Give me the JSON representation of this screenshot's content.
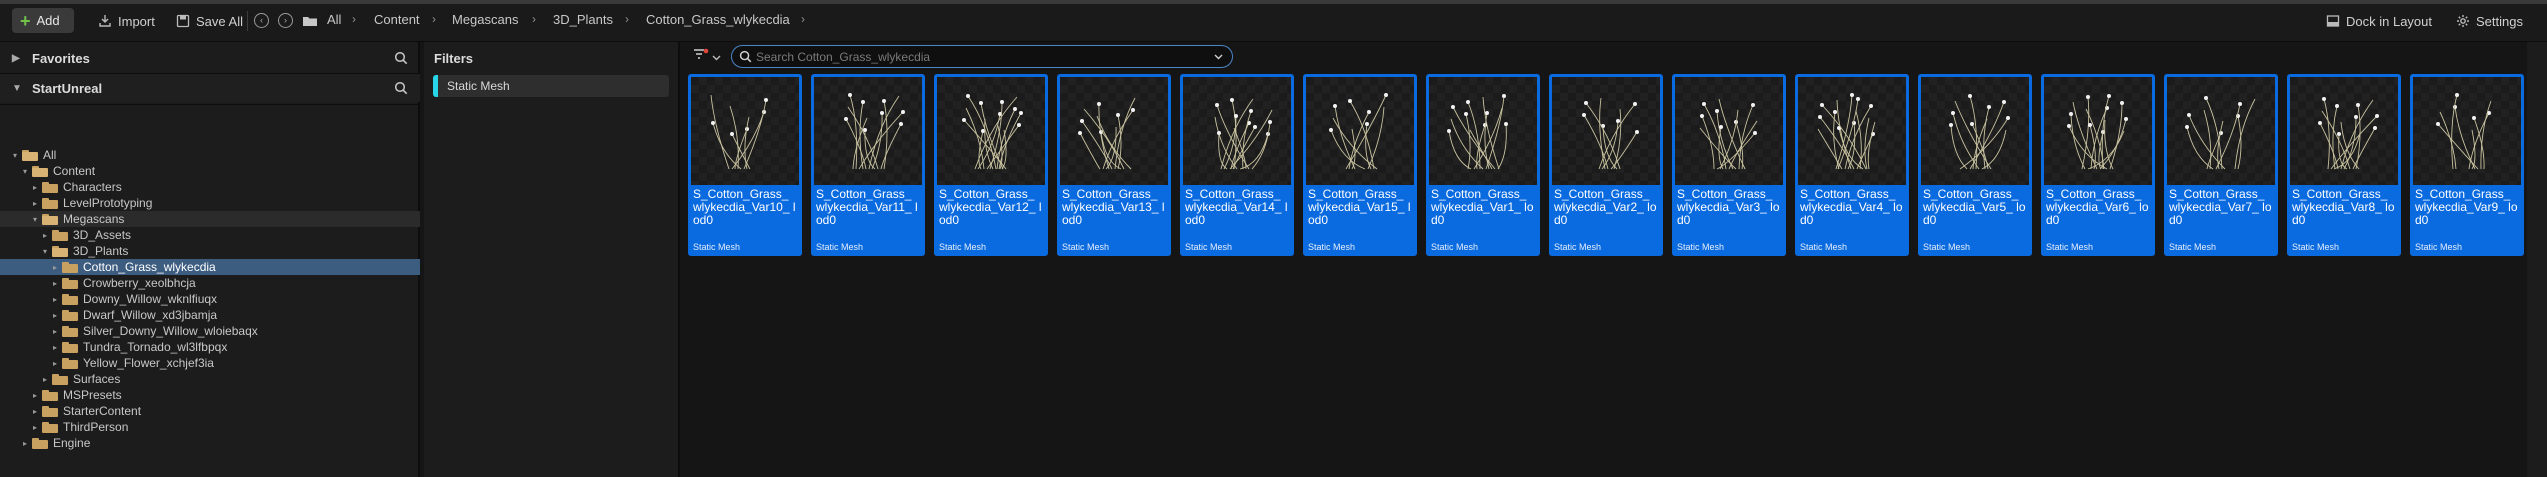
{
  "toolbar": {
    "add_label": "Add",
    "import_label": "Import",
    "save_all_label": "Save All",
    "dock_label": "Dock in Layout",
    "settings_label": "Settings"
  },
  "breadcrumb": [
    "All",
    "Content",
    "Megascans",
    "3D_Plants",
    "Cotton_Grass_wlykecdia"
  ],
  "sidebar": {
    "favorites_label": "Favorites",
    "project_label": "StartUnreal",
    "tree": [
      {
        "label": "All",
        "depth": 0,
        "expanded": true
      },
      {
        "label": "Content",
        "depth": 1,
        "expanded": true
      },
      {
        "label": "Characters",
        "depth": 2,
        "expanded": false
      },
      {
        "label": "LevelPrototyping",
        "depth": 2,
        "expanded": false
      },
      {
        "label": "Megascans",
        "depth": 2,
        "expanded": true
      },
      {
        "label": "3D_Assets",
        "depth": 3,
        "expanded": false
      },
      {
        "label": "3D_Plants",
        "depth": 3,
        "expanded": true
      },
      {
        "label": "Cotton_Grass_wlykecdia",
        "depth": 4,
        "expanded": false
      },
      {
        "label": "Crowberry_xeolbhcja",
        "depth": 4,
        "expanded": false
      },
      {
        "label": "Downy_Willow_wknlfiuqx",
        "depth": 4,
        "expanded": false
      },
      {
        "label": "Dwarf_Willow_xd3jbamja",
        "depth": 4,
        "expanded": false
      },
      {
        "label": "Silver_Downy_Willow_wloiebaqx",
        "depth": 4,
        "expanded": false
      },
      {
        "label": "Tundra_Tornado_wl3lfbpqx",
        "depth": 4,
        "expanded": false
      },
      {
        "label": "Yellow_Flower_xchjef3ia",
        "depth": 4,
        "expanded": false
      },
      {
        "label": "Surfaces",
        "depth": 3,
        "expanded": false
      },
      {
        "label": "MSPresets",
        "depth": 2,
        "expanded": false
      },
      {
        "label": "StarterContent",
        "depth": 2,
        "expanded": false
      },
      {
        "label": "ThirdPerson",
        "depth": 2,
        "expanded": false
      },
      {
        "label": "Engine",
        "depth": 1,
        "expanded": false
      }
    ]
  },
  "filters": {
    "title": "Filters",
    "active": [
      "Static Mesh"
    ]
  },
  "search": {
    "placeholder": "Search Cotton_Grass_wlykecdia",
    "value": ""
  },
  "assets": [
    {
      "label": "S_Cotton_Grass_ wlykecdia_Var10_ lod0",
      "type": "Static Mesh"
    },
    {
      "label": "S_Cotton_Grass_ wlykecdia_Var11_ lod0",
      "type": "Static Mesh"
    },
    {
      "label": "S_Cotton_Grass_ wlykecdia_Var12_ lod0",
      "type": "Static Mesh"
    },
    {
      "label": "S_Cotton_Grass_ wlykecdia_Var13_ lod0",
      "type": "Static Mesh"
    },
    {
      "label": "S_Cotton_Grass_ wlykecdia_Var14_ lod0",
      "type": "Static Mesh"
    },
    {
      "label": "S_Cotton_Grass_ wlykecdia_Var15_ lod0",
      "type": "Static Mesh"
    },
    {
      "label": "S_Cotton_Grass_ wlykecdia_Var1_ lod0",
      "type": "Static Mesh"
    },
    {
      "label": "S_Cotton_Grass_ wlykecdia_Var2_ lod0",
      "type": "Static Mesh"
    },
    {
      "label": "S_Cotton_Grass_ wlykecdia_Var3_ lod0",
      "type": "Static Mesh"
    },
    {
      "label": "S_Cotton_Grass_ wlykecdia_Var4_ lod0",
      "type": "Static Mesh"
    },
    {
      "label": "S_Cotton_Grass_ wlykecdia_Var5_ lod0",
      "type": "Static Mesh"
    },
    {
      "label": "S_Cotton_Grass_ wlykecdia_Var6_ lod0",
      "type": "Static Mesh"
    },
    {
      "label": "S_Cotton_Grass_ wlykecdia_Var7_ lod0",
      "type": "Static Mesh"
    },
    {
      "label": "S_Cotton_Grass_ wlykecdia_Var8_ lod0",
      "type": "Static Mesh"
    },
    {
      "label": "S_Cotton_Grass_ wlykecdia_Var9_ lod0",
      "type": "Static Mesh"
    }
  ],
  "colors": {
    "tile_selected": "#0a6be0",
    "filter_accent": "#27d6e8",
    "add_icon": "#72c24a",
    "folder": "#c8a060"
  }
}
